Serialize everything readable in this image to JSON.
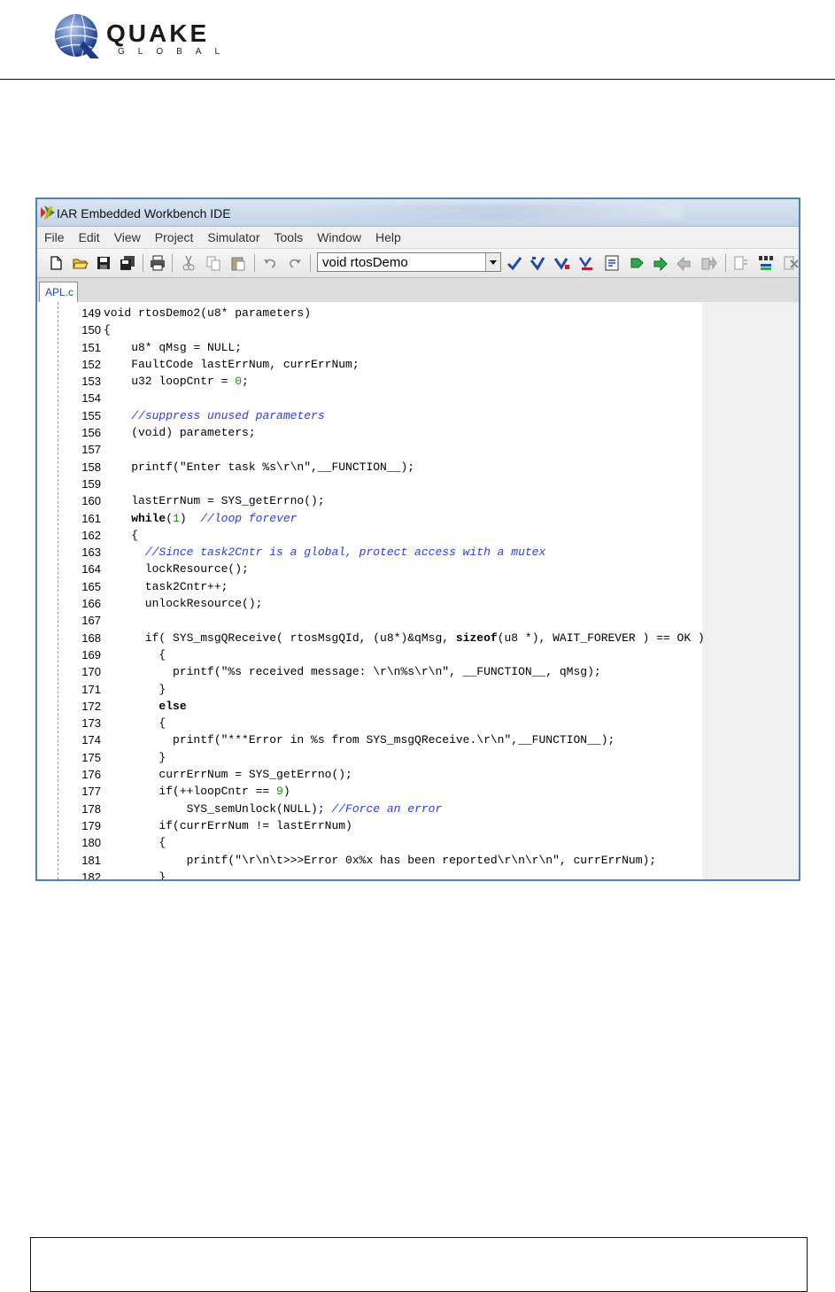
{
  "logo": {
    "brand": "QUAKE",
    "sub": "GLOBAL"
  },
  "window": {
    "title": "IAR Embedded Workbench IDE",
    "menu": [
      "File",
      "Edit",
      "View",
      "Project",
      "Simulator",
      "Tools",
      "Window",
      "Help"
    ],
    "toolbar": {
      "function_combo": "void rtosDemo"
    },
    "tab": "APL.c"
  },
  "editor": {
    "lines": [
      {
        "n": "149",
        "parts": [
          {
            "t": "void rtosDemo2(u8* parameters)"
          }
        ]
      },
      {
        "n": "150",
        "parts": [
          {
            "t": "{"
          }
        ]
      },
      {
        "n": "151",
        "parts": [
          {
            "t": "    u8* qMsg = NULL;"
          }
        ]
      },
      {
        "n": "152",
        "parts": [
          {
            "t": "    FaultCode lastErrNum, currErrNum;"
          }
        ]
      },
      {
        "n": "153",
        "parts": [
          {
            "t": "    u32 loopCntr = "
          },
          {
            "t": "0",
            "c": "num"
          },
          {
            "t": ";"
          }
        ]
      },
      {
        "n": "154",
        "parts": [
          {
            "t": ""
          }
        ]
      },
      {
        "n": "155",
        "parts": [
          {
            "t": "    "
          },
          {
            "t": "//suppress unused parameters",
            "c": "cmt"
          }
        ]
      },
      {
        "n": "156",
        "parts": [
          {
            "t": "    (void) parameters;"
          }
        ]
      },
      {
        "n": "157",
        "parts": [
          {
            "t": ""
          }
        ]
      },
      {
        "n": "158",
        "parts": [
          {
            "t": "    printf(\"Enter task %s\\r\\n\",__FUNCTION__);"
          }
        ]
      },
      {
        "n": "159",
        "parts": [
          {
            "t": ""
          }
        ]
      },
      {
        "n": "160",
        "parts": [
          {
            "t": "    lastErrNum = SYS_getErrno();"
          }
        ]
      },
      {
        "n": "161",
        "parts": [
          {
            "t": "    while",
            "c": "kw"
          },
          {
            "t": "("
          },
          {
            "t": "1",
            "c": "num"
          },
          {
            "t": ")  "
          },
          {
            "t": "//loop forever",
            "c": "cmt"
          }
        ]
      },
      {
        "n": "162",
        "parts": [
          {
            "t": "    {"
          }
        ]
      },
      {
        "n": "163",
        "parts": [
          {
            "t": "      "
          },
          {
            "t": "//Since task2Cntr is a global, protect access with a mutex",
            "c": "cmt"
          }
        ]
      },
      {
        "n": "164",
        "parts": [
          {
            "t": "      lockResource();"
          }
        ]
      },
      {
        "n": "165",
        "parts": [
          {
            "t": "      task2Cntr++;"
          }
        ]
      },
      {
        "n": "166",
        "parts": [
          {
            "t": "      unlockResource();"
          }
        ]
      },
      {
        "n": "167",
        "parts": [
          {
            "t": ""
          }
        ]
      },
      {
        "n": "168",
        "parts": [
          {
            "t": "      if( SYS_msgQReceive( rtosMsgQId, (u8*)&qMsg, "
          },
          {
            "t": "sizeof",
            "c": "kw"
          },
          {
            "t": "(u8 *), WAIT_FOREVER ) == OK )"
          }
        ]
      },
      {
        "n": "169",
        "parts": [
          {
            "t": "        {"
          }
        ]
      },
      {
        "n": "170",
        "parts": [
          {
            "t": "          printf(\"%s received message: \\r\\n%s\\r\\n\", __FUNCTION__, qMsg);"
          }
        ]
      },
      {
        "n": "171",
        "parts": [
          {
            "t": "        }"
          }
        ]
      },
      {
        "n": "172",
        "parts": [
          {
            "t": "        "
          },
          {
            "t": "else",
            "c": "kw"
          }
        ]
      },
      {
        "n": "173",
        "parts": [
          {
            "t": "        {"
          }
        ]
      },
      {
        "n": "174",
        "parts": [
          {
            "t": "          printf(\"***Error in %s from SYS_msgQReceive.\\r\\n\",__FUNCTION__);"
          }
        ]
      },
      {
        "n": "175",
        "parts": [
          {
            "t": "        }"
          }
        ]
      },
      {
        "n": "176",
        "parts": [
          {
            "t": "        currErrNum = SYS_getErrno();"
          }
        ]
      },
      {
        "n": "177",
        "parts": [
          {
            "t": "        if(++loopCntr == "
          },
          {
            "t": "9",
            "c": "num"
          },
          {
            "t": ")"
          }
        ]
      },
      {
        "n": "178",
        "parts": [
          {
            "t": "            SYS_semUnlock(NULL); "
          },
          {
            "t": "//Force an error",
            "c": "cmt"
          }
        ]
      },
      {
        "n": "179",
        "parts": [
          {
            "t": "        if(currErrNum != lastErrNum)"
          }
        ]
      },
      {
        "n": "180",
        "parts": [
          {
            "t": "        {"
          }
        ]
      },
      {
        "n": "181",
        "parts": [
          {
            "t": "            printf(\"\\r\\n\\t>>>Error 0x%x has been reported\\r\\n\\r\\n\", currErrNum);"
          }
        ]
      },
      {
        "n": "182",
        "parts": [
          {
            "t": "        }"
          }
        ]
      }
    ]
  },
  "colors": {
    "window_border": "#4f81bd",
    "comment": "#2a3ee0",
    "number": "#00a000"
  },
  "icons": [
    "new-file-icon",
    "open-folder-icon",
    "save-icon",
    "save-all-icon",
    "print-icon",
    "cut-icon",
    "copy-icon",
    "paste-icon",
    "undo-icon",
    "redo-icon",
    "check-icon",
    "compile-icon",
    "make-icon",
    "stop-build-icon",
    "debug-icon",
    "run-icon",
    "step-icon",
    "back-icon",
    "forward-icon",
    "toggle-icon",
    "breakpoint-icon",
    "close-icon"
  ]
}
